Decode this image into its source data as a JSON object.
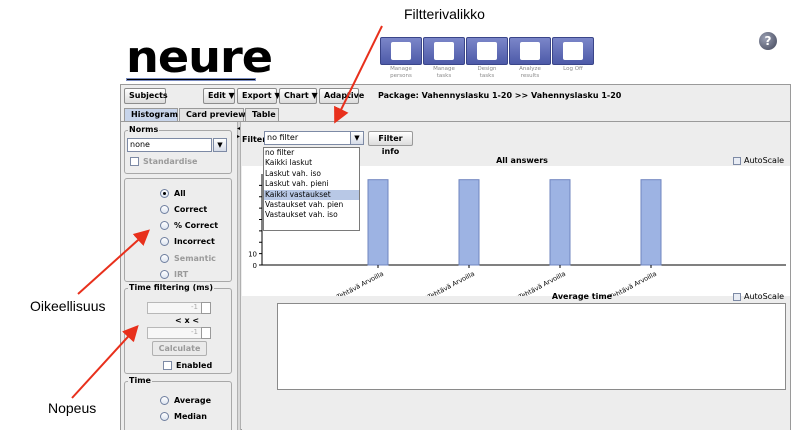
{
  "header": {
    "logo_text": "neure",
    "nav_buttons": [
      {
        "label_line1": "Manage",
        "label_line2": "persons",
        "icon": "persons-icon"
      },
      {
        "label_line1": "Manage",
        "label_line2": "tasks",
        "icon": "tasks-icon"
      },
      {
        "label_line1": "Design",
        "label_line2": "tasks",
        "icon": "design-icon"
      },
      {
        "label_line1": "Analyze",
        "label_line2": "results",
        "icon": "analyze-icon"
      },
      {
        "label_line1": "Log Off",
        "label_line2": "",
        "icon": "logoff-icon"
      }
    ],
    "help_label": "?"
  },
  "toolbar": {
    "subjects": "Subjects",
    "edit": "Edit ▼",
    "export": "Export ▼",
    "chart": "Chart ▼",
    "adaptive": "Adaptive",
    "package": "Package: Vahennyslasku 1-20 >> Vahennyslasku 1-20"
  },
  "tabs": [
    "Histogram",
    "Card preview",
    "Table"
  ],
  "norms": {
    "title": "Norms",
    "selected": "none",
    "standardise": "Standardise"
  },
  "answer_options": {
    "items": [
      {
        "label": "All",
        "selected": true,
        "disabled": false
      },
      {
        "label": "Correct",
        "selected": false,
        "disabled": false
      },
      {
        "label": "% Correct",
        "selected": false,
        "disabled": false
      },
      {
        "label": "Incorrect",
        "selected": false,
        "disabled": false
      },
      {
        "label": "Semantic",
        "selected": false,
        "disabled": true
      },
      {
        "label": "IRT",
        "selected": false,
        "disabled": true
      }
    ]
  },
  "time_filtering": {
    "title": "Time filtering (ms)",
    "spin1": "-1",
    "between": "< x <",
    "spin2": "-1",
    "calculate": "Calculate",
    "enabled": "Enabled"
  },
  "time": {
    "title": "Time",
    "options": [
      "Average",
      "Median"
    ]
  },
  "filter": {
    "label": "Filter",
    "selected": "no filter",
    "info_button": "Filter info",
    "options": [
      "no filter",
      "Kaikki laskut",
      "Laskut vah. iso",
      "Laskut vah. pieni",
      "Kaikki vastaukset",
      "Vastaukset vah. pien",
      "Vastaukset vah. iso"
    ],
    "highlighted_index": 4
  },
  "charts": {
    "autoscale": "AutoScale",
    "average_time_title": "Average time"
  },
  "chart_data": {
    "type": "bar",
    "title": "All answers",
    "categories": [
      "1Tehtävä Arvoilla",
      "2Tehtävä Arvoilla",
      "3Tehtävä Arvoilla",
      "4Tehtävä Arvoilla"
    ],
    "values": [
      75,
      75,
      75,
      75
    ],
    "yticks": [
      "10",
      "0"
    ],
    "colors": {
      "bar": "#9db3e3"
    }
  },
  "annotations": {
    "filter_menu": "Filtterivalikko",
    "correctness": "Oikeellisuus",
    "speed": "Nopeus"
  }
}
